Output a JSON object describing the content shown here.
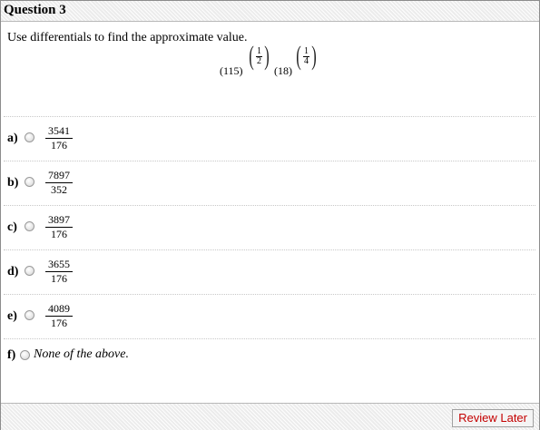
{
  "header": {
    "title": "Question 3"
  },
  "question": {
    "prompt": "Use differentials to find the approximate value.",
    "expression": {
      "base1": "(115)",
      "exp1_num": "1",
      "exp1_den": "2",
      "base2": "(18)",
      "exp2_num": "1",
      "exp2_den": "4"
    }
  },
  "options": [
    {
      "letter": "a)",
      "numerator": "3541",
      "denominator": "176"
    },
    {
      "letter": "b)",
      "numerator": "7897",
      "denominator": "352"
    },
    {
      "letter": "c)",
      "numerator": "3897",
      "denominator": "176"
    },
    {
      "letter": "d)",
      "numerator": "3655",
      "denominator": "176"
    },
    {
      "letter": "e)",
      "numerator": "4089",
      "denominator": "176"
    },
    {
      "letter": "f)",
      "text": "None of the above."
    }
  ],
  "footer": {
    "review_label": "Review Later"
  }
}
